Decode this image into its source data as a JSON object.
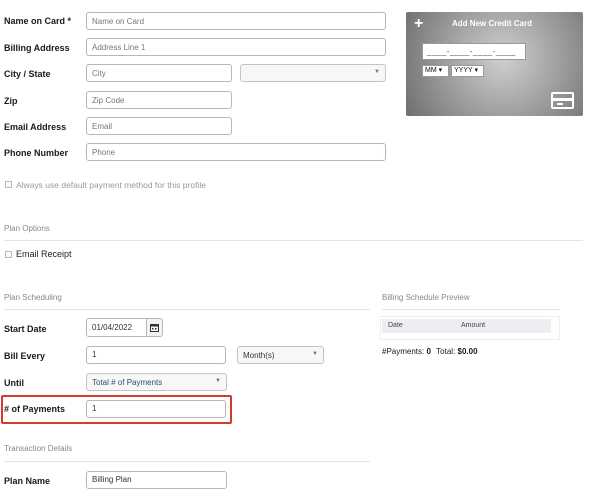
{
  "form": {
    "name_on_card": {
      "label": "Name on Card *",
      "placeholder": "Name on Card"
    },
    "billing_address": {
      "label": "Billing Address",
      "placeholder": "Address Line 1"
    },
    "city_state": {
      "label": "City / State",
      "placeholder": "City",
      "state_value": ""
    },
    "zip": {
      "label": "Zip",
      "placeholder": "Zip Code"
    },
    "email": {
      "label": "Email Address",
      "placeholder": "Email"
    },
    "phone": {
      "label": "Phone Number",
      "placeholder": "Phone"
    },
    "default_payment": {
      "label": "Always use default payment method for this profile",
      "checked": false
    }
  },
  "card": {
    "title": "Add New Credit Card",
    "number_mask": "____-____-____-____",
    "month_select": "MM",
    "year_select": "YYYY"
  },
  "plan_options": {
    "title": "Plan Options",
    "email_receipt": {
      "label": "Email Receipt",
      "checked": false
    }
  },
  "plan_scheduling": {
    "title": "Plan Scheduling",
    "start_date": {
      "label": "Start Date",
      "value": "01/04/2022"
    },
    "bill_every": {
      "label": "Bill Every",
      "value": "1",
      "unit": "Month(s)"
    },
    "until": {
      "label": "Until",
      "value": "Total # of Payments"
    },
    "num_payments": {
      "label": "# of Payments",
      "value": "1"
    }
  },
  "preview": {
    "title": "Billing Schedule Preview",
    "columns": [
      "Date",
      "Amount"
    ],
    "payments_label": "#Payments:",
    "payments_value": "0",
    "total_label": "Total:",
    "total_value": "$0.00"
  },
  "transaction": {
    "title": "Transaction Details",
    "plan_name": {
      "label": "Plan Name",
      "value": "Billing Plan"
    }
  },
  "colors": {
    "highlight": "#d53a2a",
    "card_bg": "#9a9a9a"
  },
  "icons": {
    "add": "plus-icon",
    "calendar": "calendar-icon",
    "credit_card": "credit-card-icon"
  }
}
